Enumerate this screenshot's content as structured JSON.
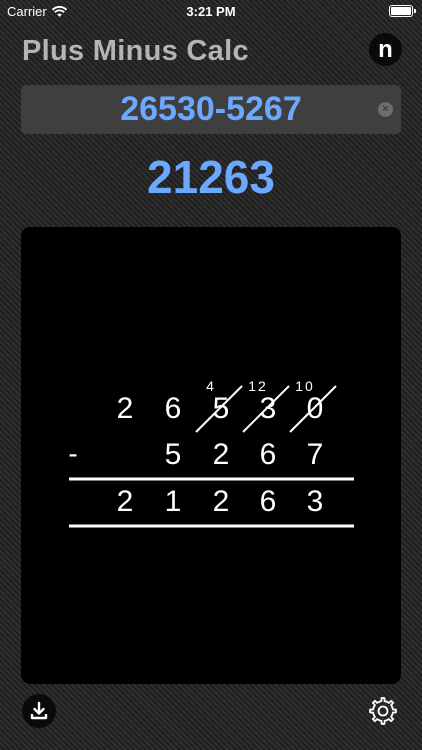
{
  "status": {
    "carrier": "Carrier",
    "time": "3:21 PM",
    "battery_level": 1.0
  },
  "header": {
    "title": "Plus Minus Calc",
    "n_button_label": "n"
  },
  "expression": {
    "value": "26530-5267"
  },
  "result": {
    "value": "21263"
  },
  "work": {
    "minuend_digits": [
      "2",
      "6",
      "5",
      "3",
      "0"
    ],
    "borrow_marks": [
      "",
      "",
      "4",
      "12",
      "10"
    ],
    "crossed": [
      false,
      false,
      true,
      true,
      true
    ],
    "operator": "-",
    "subtrahend_digits": [
      "",
      "5",
      "2",
      "6",
      "7"
    ],
    "answer_digits": [
      "2",
      "1",
      "2",
      "6",
      "3"
    ]
  },
  "icons": {
    "download": "download-icon",
    "settings": "gear-icon",
    "wifi": "wifi-icon",
    "clear": "clear-icon"
  },
  "colors": {
    "accent": "#6aa9ff",
    "title": "#b4b4b4",
    "field": "#3f3f3f"
  }
}
